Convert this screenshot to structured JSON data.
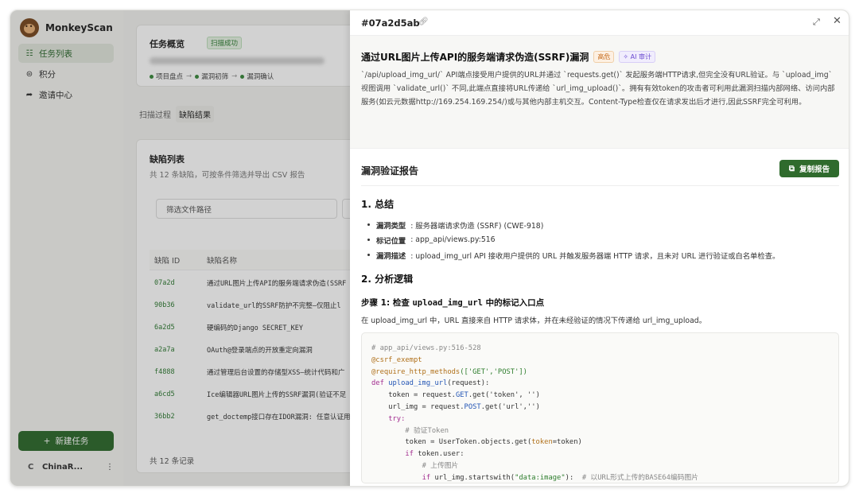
{
  "brand": {
    "name": "MonkeyScan"
  },
  "sidebar": {
    "items": [
      {
        "label": "任务列表",
        "icon": "list-icon",
        "active": true
      },
      {
        "label": "积分",
        "icon": "coin-icon",
        "active": false
      },
      {
        "label": "邀请中心",
        "icon": "share-icon",
        "active": false
      }
    ],
    "new_task_label": "新建任务",
    "user": {
      "avatar": "C",
      "name": "ChinaR...",
      "menu_icon": "more-icon"
    }
  },
  "overview": {
    "title": "任务概览",
    "status": "扫描成功",
    "steps": [
      "项目盘点",
      "漏洞初筛",
      "漏洞确认"
    ]
  },
  "tabs": [
    {
      "label": "扫描过程"
    },
    {
      "label": "缺陷结果"
    }
  ],
  "defects": {
    "title": "缺陷列表",
    "subtitle": "共 12 条缺陷，可按条件筛选并导出 CSV 报告",
    "filter_placeholder": "筛选文件路径",
    "columns": [
      "缺陷 ID",
      "缺陷名称"
    ],
    "rows": [
      {
        "id": "07a2d",
        "name": "通过URL图片上传API的服务端请求伪造(SSRF"
      },
      {
        "id": "90b36",
        "name": "validate_url的SSRF防护不完整—仅阻止l"
      },
      {
        "id": "6a2d5",
        "name": "硬编码的Django SECRET_KEY"
      },
      {
        "id": "a2a7a",
        "name": "OAuth@登录端点的开放重定向漏洞"
      },
      {
        "id": "f4888",
        "name": "通过管理后台设置的存储型XSS—统计代码和广"
      },
      {
        "id": "a6cd5",
        "name": "Ice编辑器URL图片上传的SSRF漏洞(验证不足"
      },
      {
        "id": "36bb2",
        "name": "get_doctemp接口存在IDOR漏洞: 任意认证用"
      }
    ],
    "total": "共 12 条记录"
  },
  "drawer": {
    "id": "#07a2d5ab",
    "title": "通过URL图片上传API的服务端请求伪造(SSRF)漏洞",
    "severity": "高危",
    "ai_badge": "AI 审计",
    "description": "`/api/upload_img_url/` API端点接受用户提供的URL并通过 `requests.get()` 发起服务端HTTP请求,但完全没有URL验证。与 `upload_img` 视图调用 `validate_url()` 不同,此端点直接将URL传递给 `url_img_upload()`。拥有有效token的攻击者可利用此漏洞扫描内部网络、访问内部服务(如云元数据http://169.254.169.254/)或与其他内部主机交互。Content-Type检查仅在请求发出后才进行,因此SSRF完全可利用。",
    "report_title": "漏洞验证报告",
    "copy_label": "复制报告",
    "summary_heading": "1. 总结",
    "summary": [
      {
        "label": "漏洞类型",
        "value": ": 服务器端请求伪造 (SSRF) (CWE-918)"
      },
      {
        "label": "标记位置",
        "value": ": app_api/views.py:516"
      },
      {
        "label": "漏洞描述",
        "value": ": upload_img_url API 接收用户提供的 URL 并触发服务器端 HTTP 请求，且未对 URL 进行验证或白名单检查。"
      }
    ],
    "logic_heading": "2. 分析逻辑",
    "step_prefix": "步骤 1: 检查 ",
    "step_code": "upload_img_url",
    "step_suffix": " 中的标记入口点",
    "step_desc": "在 upload_img_url 中，URL 直接来自 HTTP 请求体，并在未经验证的情况下传递给 url_img_upload。",
    "code": {
      "comment1": "# app_api/views.py:516-528",
      "dec1": "@csrf_exempt",
      "dec2_name": "@require_http_methods",
      "dec2_args": "(['GET','POST'])",
      "def_kw": "def",
      "def_name": "upload_img_url",
      "def_args": "(request):",
      "l1_a": "token = request.",
      "l1_b": "GET",
      "l1_c": ".get('token', '')",
      "l2_a": "url_img = request.",
      "l2_b": "POST",
      "l2_c": ".get('url','')",
      "try_kw": "try:",
      "c2": "# 验证Token",
      "l3_a": "token = UserToken.objects.get(",
      "l3_b": "token",
      "l3_c": "=token)",
      "if_kw": "if",
      "if_rest": " token.user:",
      "c3": "# 上传图片",
      "l4_a": "if",
      "l4_b": " url_img.startswith(",
      "l4_c": "\"data:image\"",
      "l4_d": "):  ",
      "l4_e": "# 以URL形式上传的BASE64编码图片"
    }
  }
}
